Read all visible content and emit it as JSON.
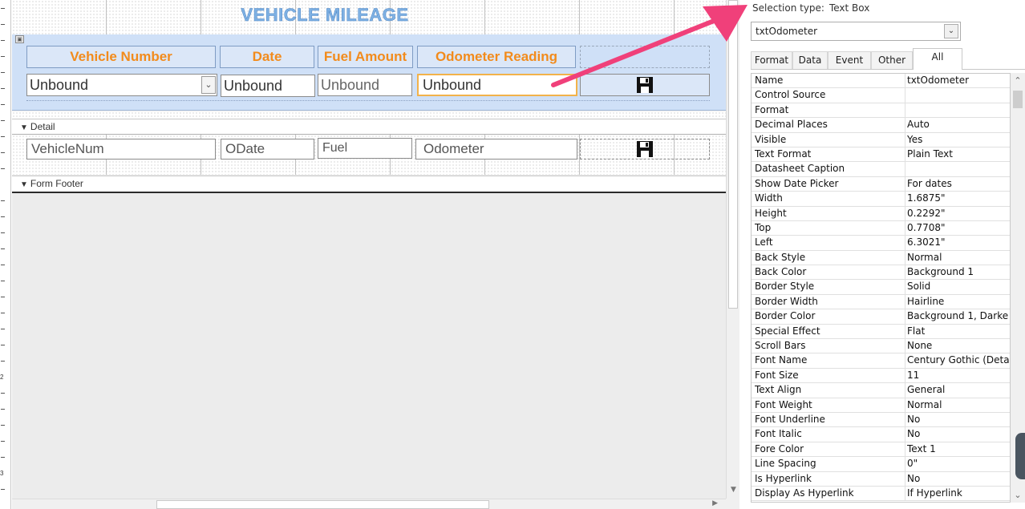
{
  "form": {
    "title": "VEHICLE MILEAGE",
    "header_labels": [
      "Vehicle Number",
      "Date",
      "Fuel Amount",
      "Odometer Reading"
    ],
    "header_fields": {
      "vehicle": "Unbound",
      "date": "Unbound",
      "fuel": "Unbound",
      "odometer": "Unbound"
    },
    "sections": {
      "detail": "Detail",
      "footer": "Form Footer"
    },
    "detail_fields": {
      "vehicle": "VehicleNum",
      "date": "ODate",
      "fuel": "Fuel",
      "odometer": "Odometer"
    },
    "ruler_numbers": [
      "2",
      "3"
    ]
  },
  "property_sheet": {
    "selection_type_label": "Selection type:",
    "selection_type_value": "Text Box",
    "selected_object": "txtOdometer",
    "tabs": [
      "Format",
      "Data",
      "Event",
      "Other",
      "All"
    ],
    "active_tab": "All",
    "properties": [
      {
        "name": "Name",
        "value": "txtOdometer"
      },
      {
        "name": "Control Source",
        "value": ""
      },
      {
        "name": "Format",
        "value": ""
      },
      {
        "name": "Decimal Places",
        "value": "Auto"
      },
      {
        "name": "Visible",
        "value": "Yes"
      },
      {
        "name": "Text Format",
        "value": "Plain Text"
      },
      {
        "name": "Datasheet Caption",
        "value": ""
      },
      {
        "name": "Show Date Picker",
        "value": "For dates"
      },
      {
        "name": "Width",
        "value": "1.6875\""
      },
      {
        "name": "Height",
        "value": "0.2292\""
      },
      {
        "name": "Top",
        "value": "0.7708\""
      },
      {
        "name": "Left",
        "value": "6.3021\""
      },
      {
        "name": "Back Style",
        "value": "Normal"
      },
      {
        "name": "Back Color",
        "value": "Background 1"
      },
      {
        "name": "Border Style",
        "value": "Solid"
      },
      {
        "name": "Border Width",
        "value": "Hairline"
      },
      {
        "name": "Border Color",
        "value": "Background 1, Darke"
      },
      {
        "name": "Special Effect",
        "value": "Flat"
      },
      {
        "name": "Scroll Bars",
        "value": "None"
      },
      {
        "name": "Font Name",
        "value": "Century Gothic (Deta"
      },
      {
        "name": "Font Size",
        "value": "11"
      },
      {
        "name": "Text Align",
        "value": "General"
      },
      {
        "name": "Font Weight",
        "value": "Normal"
      },
      {
        "name": "Font Underline",
        "value": "No"
      },
      {
        "name": "Font Italic",
        "value": "No"
      },
      {
        "name": "Fore Color",
        "value": "Text 1"
      },
      {
        "name": "Line Spacing",
        "value": "0\""
      },
      {
        "name": "Is Hyperlink",
        "value": "No"
      },
      {
        "name": "Display As Hyperlink",
        "value": "If Hyperlink"
      }
    ]
  },
  "colors": {
    "label_text": "#f28b1c",
    "title_text": "#7fb1e3",
    "header_band": "#cfe0f7",
    "selected_border": "#f2b24a",
    "annotation_arrow": "#f0407a"
  },
  "icons": {
    "save": "floppy-disk-icon",
    "dropdown": "chevron-down-icon",
    "section_marker": "section-arrow-icon"
  }
}
